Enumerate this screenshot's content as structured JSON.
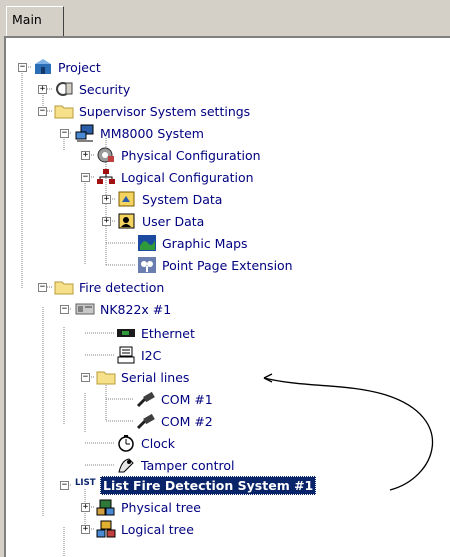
{
  "tabs": [
    {
      "label": "Main"
    }
  ],
  "tree": [
    {
      "label": "Project",
      "icon": "project-icon"
    },
    {
      "label": "Security",
      "icon": "security-icon"
    },
    {
      "label": "Supervisor System settings",
      "icon": "folder-icon"
    },
    {
      "label": "MM8000 System",
      "icon": "computer-network-icon"
    },
    {
      "label": "Physical Configuration",
      "icon": "physical-configuration-icon"
    },
    {
      "label": "Logical Configuration",
      "icon": "logical-configuration-icon"
    },
    {
      "label": "System Data",
      "icon": "system-data-icon"
    },
    {
      "label": "User Data",
      "icon": "user-data-icon"
    },
    {
      "label": "Graphic Maps",
      "icon": "graphic-map-icon"
    },
    {
      "label": "Point Page Extension",
      "icon": "point-page-icon"
    },
    {
      "label": "Fire detection",
      "icon": "folder-icon"
    },
    {
      "label": "NK822x #1",
      "icon": "panel-device-icon"
    },
    {
      "label": "Ethernet",
      "icon": "ethernet-icon"
    },
    {
      "label": "I2C",
      "icon": "i2c-icon"
    },
    {
      "label": "Serial lines",
      "icon": "folder-icon"
    },
    {
      "label": "COM #1",
      "icon": "serial-cable-icon"
    },
    {
      "label": "COM #2",
      "icon": "serial-cable-icon"
    },
    {
      "label": "Clock",
      "icon": "clock-icon"
    },
    {
      "label": "Tamper control",
      "icon": "tamper-icon"
    },
    {
      "label": "List Fire Detection System #1",
      "icon": "list-icon",
      "badge": "LIST",
      "selected": true
    },
    {
      "label": "Physical tree",
      "icon": "physical-tree-icon"
    },
    {
      "label": "Logical tree",
      "icon": "logical-tree-icon"
    }
  ]
}
